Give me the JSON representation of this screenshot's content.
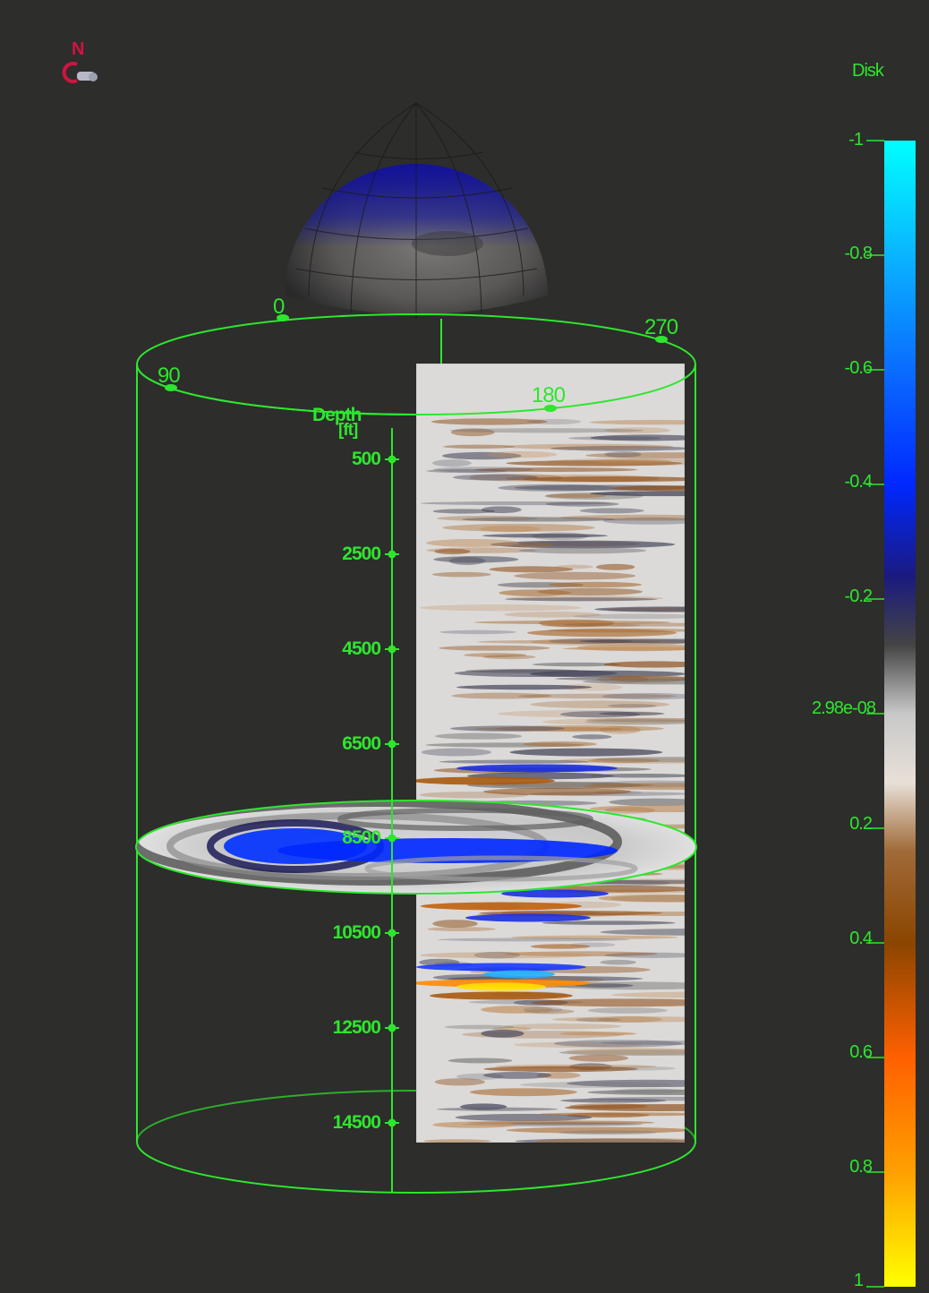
{
  "compass": {
    "north_label": "N",
    "icon": "compass-orientation-icon"
  },
  "azimuth_labels": [
    "0",
    "270",
    "90",
    "180"
  ],
  "depth_axis": {
    "title": "Depth",
    "unit": "[ft]",
    "ticks": [
      "500",
      "2500",
      "4500",
      "6500",
      "8500",
      "10500",
      "12500",
      "14500"
    ]
  },
  "colorbar": {
    "title": "Disk",
    "min": -1,
    "max": 1,
    "ticks": [
      "-1",
      "-0.8",
      "-0.6",
      "-0.4",
      "-0.2",
      "2.98e-08",
      "0.2",
      "0.4",
      "0.6",
      "0.8",
      "1"
    ],
    "colors": [
      "#00ffff",
      "#0a8cff",
      "#0033ff",
      "#1e1e6e",
      "#555555",
      "#d0d0d0",
      "#ffffff",
      "#b07a40",
      "#8b4500",
      "#ff6a00",
      "#ffaa00",
      "#ffff00"
    ]
  },
  "colors": {
    "accent": "#2ee62e",
    "background": "#2d2d2b",
    "compass": "#d01440"
  }
}
